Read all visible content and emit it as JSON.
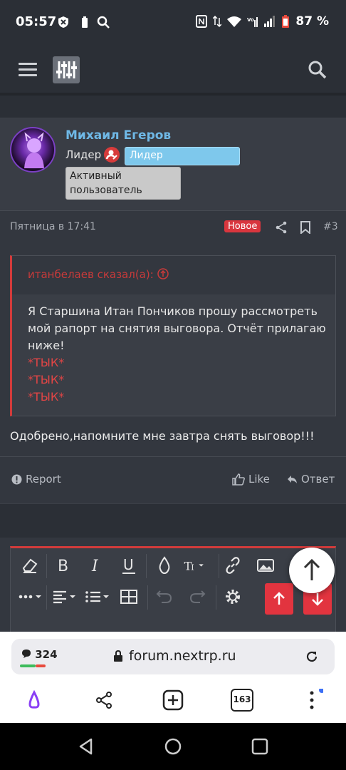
{
  "status_bar": {
    "time": "05:57",
    "battery": "87 %"
  },
  "post": {
    "username": "Михаил Егеров",
    "role_label": "Лидер",
    "role_badge": "Лидер",
    "activity_badge": "Активный пользователь",
    "date": "Пятница в 17:41",
    "new_badge": "Новое",
    "post_number": "#3",
    "quote": {
      "author": "итанбелаев сказал(а):",
      "text": "Я Старшина Итан Пончиков прошу рассмотреть мой рапорт на снятия выговора. Отчёт прилагаю ниже!",
      "links": [
        "*ТЫК*",
        "*ТЫК*",
        "*ТЫК*"
      ]
    },
    "reply": "Одобрено,напомните мне завтра снять выговор!!!",
    "actions": {
      "report": "Report",
      "like": "Like",
      "reply": "Ответ"
    }
  },
  "browser": {
    "comments_count": "324",
    "url": "forum.nextrp.ru",
    "tabs_count": "163"
  },
  "colors": {
    "accent_red": "#d23b3b",
    "username_blue": "#6fb8e6",
    "role_badge_bg": "#7ec8ec"
  }
}
